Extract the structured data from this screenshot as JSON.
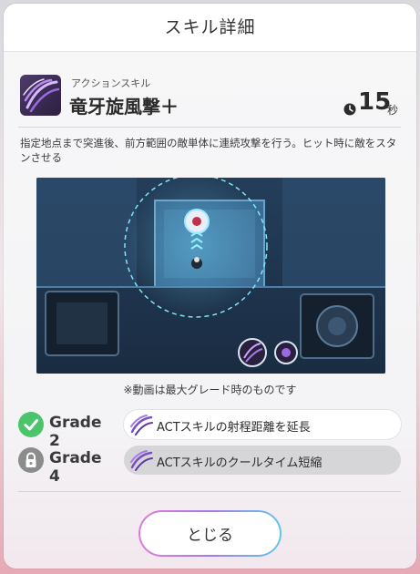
{
  "dialog": {
    "title": "スキル詳細",
    "close_label": "とじる"
  },
  "skill": {
    "icon": "purple-claw-slash-icon",
    "type": "アクションスキル",
    "name": "竜牙旋風撃＋",
    "cooldown_value": "15",
    "cooldown_unit": "秒",
    "description": "指定地点まで突進後、前方範囲の敵単体に連続攻撃を行う。ヒット時に敵をスタンさせる"
  },
  "preview": {
    "caption": "※動画は最大グレード時のものです"
  },
  "grades": [
    {
      "label": "Grade 2",
      "status": "unlocked",
      "status_icon": "check-circle-icon",
      "text": "ACTスキルの射程距離を延長"
    },
    {
      "label": "Grade 4",
      "status": "locked",
      "status_icon": "lock-icon",
      "text": "ACTスキルのクールタイム短縮"
    }
  ],
  "colors": {
    "accent_green": "#4cc46b",
    "locked_gray": "#8c8c8c",
    "skill_purple": "#7b4fc4"
  }
}
